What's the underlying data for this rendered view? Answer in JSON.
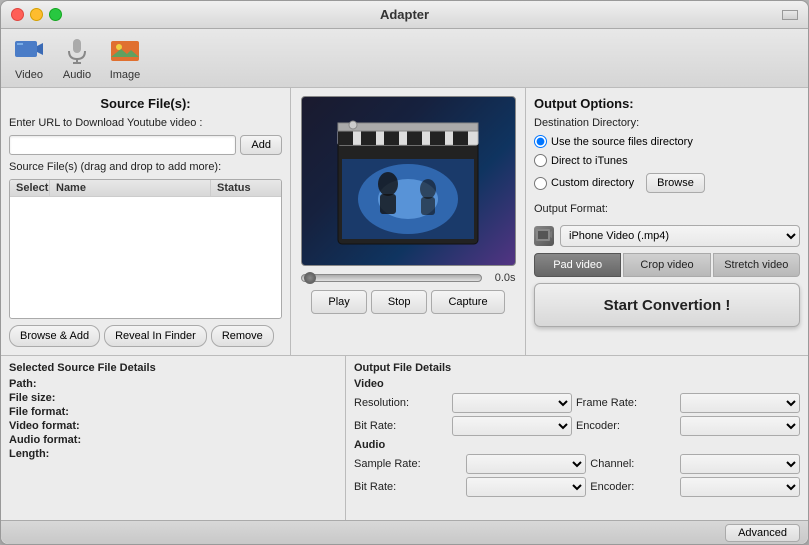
{
  "window": {
    "title": "Adapter"
  },
  "titlebar": {
    "title": "Adapter"
  },
  "toolbar": {
    "items": [
      {
        "id": "video",
        "label": "Video"
      },
      {
        "id": "audio",
        "label": "Audio"
      },
      {
        "id": "image",
        "label": "Image"
      }
    ]
  },
  "source": {
    "section_title": "Source File(s):",
    "url_label": "Enter URL to Download Youtube video :",
    "url_placeholder": "",
    "add_button": "Add",
    "drag_label": "Source File(s) (drag and drop to add more):",
    "table_headers": [
      "Select",
      "Name",
      "Status"
    ],
    "browse_add_button": "Browse & Add",
    "reveal_button": "Reveal In Finder",
    "remove_button": "Remove"
  },
  "preview": {
    "time": "0.0s",
    "play_button": "Play",
    "stop_button": "Stop",
    "capture_button": "Capture"
  },
  "output_options": {
    "section_title": "Output Options:",
    "destination_label": "Destination Directory:",
    "radio_source": "Use the source files directory",
    "radio_itunes": "Direct to iTunes",
    "radio_custom": "Custom directory",
    "browse_button": "Browse",
    "format_label": "Output Format:",
    "format_value": "iPhone Video (.mp4)",
    "pad_button": "Pad video",
    "crop_button": "Crop video",
    "stretch_button": "Stretch video",
    "convert_button": "Start Convertion !"
  },
  "selected_file_details": {
    "section_title": "Selected Source File Details",
    "path_label": "Path:",
    "path_value": "",
    "filesize_label": "File size:",
    "filesize_value": "",
    "fileformat_label": "File format:",
    "fileformat_value": "",
    "videoformat_label": "Video format:",
    "videoformat_value": "",
    "audioformat_label": "Audio format:",
    "audioformat_value": "",
    "length_label": "Length:",
    "length_value": ""
  },
  "output_file_details": {
    "section_title": "Output File Details",
    "video_label": "Video",
    "resolution_label": "Resolution:",
    "framerate_label": "Frame Rate:",
    "bitrate_label": "Bit Rate:",
    "encoder_label": "Encoder:",
    "audio_label": "Audio",
    "samplerate_label": "Sample Rate:",
    "channel_label": "Channel:",
    "audio_bitrate_label": "Bit Rate:",
    "audio_encoder_label": "Encoder:"
  },
  "statusbar": {
    "advanced_button": "Advanced"
  }
}
